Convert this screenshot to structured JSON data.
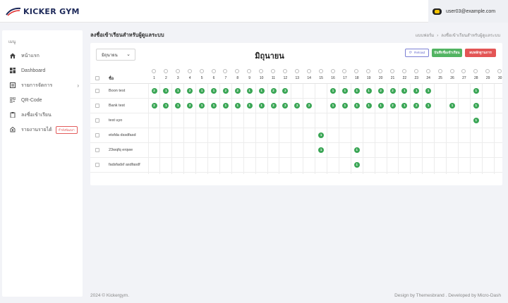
{
  "brand": {
    "name": "KICKER GYM"
  },
  "user": {
    "email": "user03@example.com"
  },
  "sidebar": {
    "title": "เมนู",
    "items": [
      {
        "label": "หน้าแรก",
        "icon": "home-icon"
      },
      {
        "label": "Dashboard",
        "icon": "dashboard-icon"
      },
      {
        "label": "รายการจัดการ",
        "icon": "list-icon",
        "has_chevron": true
      },
      {
        "label": "QR-Code",
        "icon": "qr-icon"
      },
      {
        "label": "ลงชื่อเข้าเรียน",
        "icon": "clipboard-icon"
      },
      {
        "label": "รายงานรายได้",
        "icon": "report-icon",
        "badge": "กำลังพัฒนา"
      }
    ]
  },
  "page": {
    "title": "ลงชื่อเข้าเรียนสำหรับผู้ดูแลระบบ",
    "breadcrumb": [
      "แบบฟอร์ม",
      "ลงชื่อเข้าเรียนสำหรับผู้ดูแลระบบ"
    ]
  },
  "toolbar": {
    "month_value": "มิถุนายน",
    "month_title": "มิถุนายน",
    "reload_label": "Reload",
    "checkin_label": "บันทึกชื่อเข้าเรียน",
    "delete_label": "ลบหลักฐานการ"
  },
  "table": {
    "name_header": "ชื่อ",
    "days": [
      "1",
      "2",
      "3",
      "4",
      "5",
      "6",
      "7",
      "8",
      "9",
      "10",
      "11",
      "12",
      "13",
      "14",
      "15",
      "16",
      "17",
      "18",
      "19",
      "20",
      "21",
      "22",
      "23",
      "24",
      "25",
      "26",
      "27",
      "28",
      "29",
      "30"
    ],
    "rows": [
      {
        "name": "Boon test",
        "marks": {
          "1": "2",
          "2": "1",
          "3": "1",
          "4": "2",
          "5": "1",
          "6": "1",
          "7": "2",
          "8": "2",
          "9": "1",
          "10": "1",
          "11": "2",
          "12": "2",
          "16": "1",
          "17": "1",
          "18": "1",
          "19": "1",
          "20": "2",
          "21": "2",
          "22": "1",
          "23": "1",
          "24": "1",
          "28": "1"
        }
      },
      {
        "name": "Bank test",
        "marks": {
          "1": "2",
          "2": "1",
          "3": "1",
          "4": "2",
          "5": "1",
          "6": "1",
          "7": "1",
          "8": "1",
          "9": "1",
          "10": "1",
          "11": "2",
          "12": "2",
          "13": "2",
          "14": "2",
          "16": "1",
          "17": "1",
          "18": "1",
          "19": "1",
          "20": "1",
          "21": "2",
          "22": "1",
          "23": "2",
          "24": "1",
          "26": "1",
          "28": "1"
        }
      },
      {
        "name": "test uyo",
        "marks": {
          "28": "1"
        }
      },
      {
        "name": "etsfda dssdfasd",
        "marks": {
          "15": "1"
        }
      },
      {
        "name": "23wqfq erqwe",
        "marks": {
          "15": "1",
          "18": "1"
        }
      },
      {
        "name": "fadsfadsf asdfasdf",
        "marks": {
          "18": "1"
        }
      }
    ]
  },
  "footer": {
    "left": "2024 © Kickergym.",
    "right": "Design by Themesbrand . Developed by Micro-Dash"
  },
  "colors": {
    "primary": "#52b462",
    "danger": "#e35555",
    "mark": "#3aa655",
    "accent": "#6b6fcf"
  }
}
